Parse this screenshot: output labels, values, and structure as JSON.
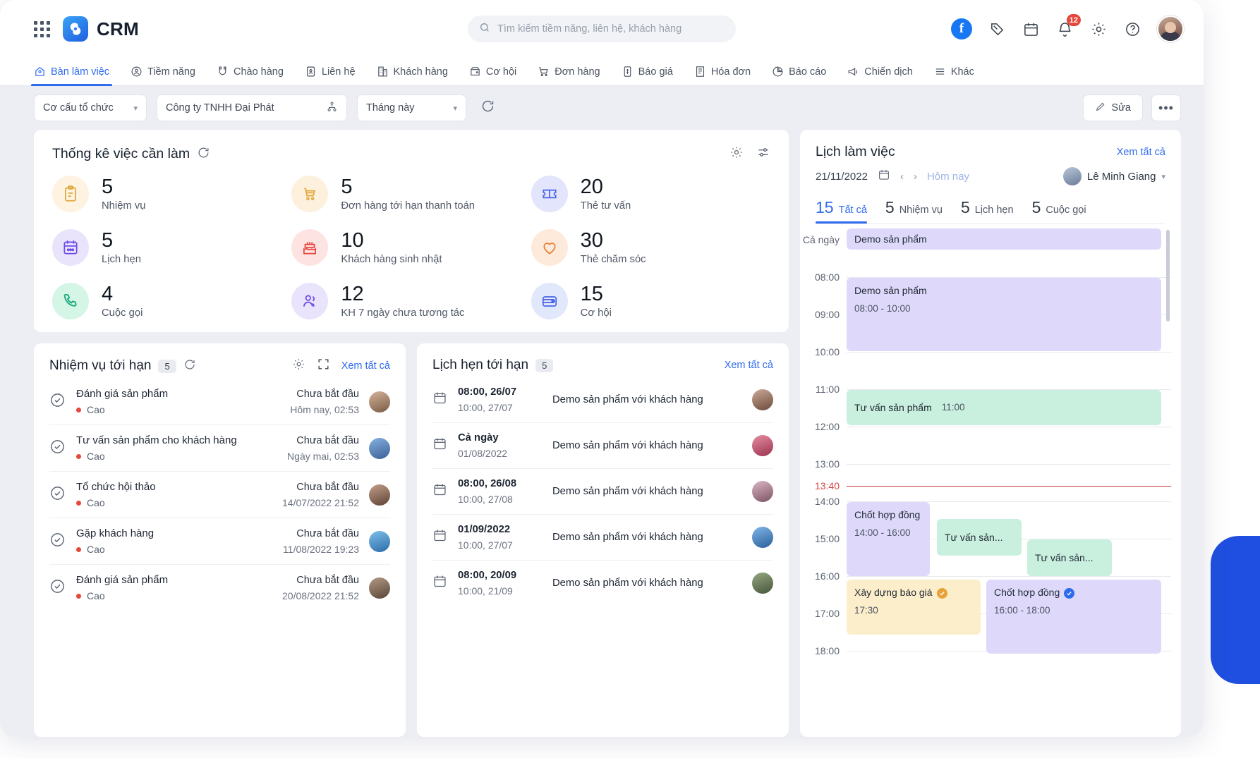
{
  "header": {
    "brand": "CRM",
    "grid_icon": "apps-grid-icon",
    "search": {
      "placeholder": "Tìm kiếm tiềm năng, liên hệ, khách hàng",
      "value": ""
    },
    "icons": {
      "facebook": "f",
      "zalo": "zalo-icon",
      "calendar": "calendar-icon",
      "bell": "bell-icon",
      "settings": "gear-icon",
      "help": "help-icon",
      "avatar": "user-avatar"
    },
    "notification_count": "12"
  },
  "nav": {
    "tabs": [
      {
        "label": "Bàn làm việc",
        "icon": "workspace-icon",
        "active": true
      },
      {
        "label": "Tiềm năng",
        "icon": "lead-icon",
        "active": false
      },
      {
        "label": "Chào hàng",
        "icon": "offer-icon",
        "active": false
      },
      {
        "label": "Liên hệ",
        "icon": "contact-icon",
        "active": false
      },
      {
        "label": "Khách hàng",
        "icon": "customer-icon",
        "active": false
      },
      {
        "label": "Cơ hội",
        "icon": "opportunity-icon",
        "active": false
      },
      {
        "label": "Đơn hàng",
        "icon": "order-cart-icon",
        "active": false
      },
      {
        "label": "Báo giá",
        "icon": "quote-icon",
        "active": false
      },
      {
        "label": "Hóa đơn",
        "icon": "invoice-icon",
        "active": false
      },
      {
        "label": "Báo cáo",
        "icon": "report-chart-icon",
        "active": false
      },
      {
        "label": "Chiến dịch",
        "icon": "campaign-icon",
        "active": false
      },
      {
        "label": "Khác",
        "icon": "more-menu-icon",
        "active": false
      }
    ]
  },
  "filterbar": {
    "org_structure": "Cơ cấu tổ chức",
    "company": "Công ty TNHH Đại Phát",
    "period": "Tháng này",
    "refresh_icon": "refresh-icon",
    "edit_label": "Sửa",
    "more_label": "•••"
  },
  "stats": {
    "title": "Thống kê việc cần làm",
    "refresh_icon": "refresh-icon",
    "gear_icon": "gear-icon",
    "filter_icon": "sliders-icon",
    "items": [
      {
        "value": "5",
        "label": "Nhiệm vụ",
        "icon": "clipboard-icon",
        "color": "#e0a73a",
        "bg": "#fdf3e0"
      },
      {
        "value": "5",
        "label": "Đơn hàng tới hạn thanh toán",
        "icon": "cart-icon",
        "color": "#e0a73a",
        "bg": "#fdf0dc"
      },
      {
        "value": "20",
        "label": "Thẻ tư vấn",
        "icon": "ticket-icon",
        "color": "#4a63e8",
        "bg": "#e2e5fb"
      },
      {
        "value": "5",
        "label": "Lịch hẹn",
        "icon": "calendar-icon",
        "color": "#6b4ae8",
        "bg": "#e9e4fc"
      },
      {
        "value": "10",
        "label": "Khách hàng sinh nhật",
        "icon": "cake-icon",
        "color": "#e8453c",
        "bg": "#fde3e2"
      },
      {
        "value": "30",
        "label": "Thẻ chăm sóc",
        "icon": "heart-icon",
        "color": "#e8823a",
        "bg": "#fdeadb"
      },
      {
        "value": "4",
        "label": "Cuộc gọi",
        "icon": "phone-icon",
        "color": "#17a97c",
        "bg": "#d5f5e6"
      },
      {
        "value": "12",
        "label": "KH 7 ngày chưa tương tác",
        "icon": "users-icon",
        "color": "#6b4ae8",
        "bg": "#e9e4fc"
      },
      {
        "value": "15",
        "label": "Cơ hội",
        "icon": "wallet-icon",
        "color": "#4a63e8",
        "bg": "#e2e8fb"
      }
    ]
  },
  "tasks": {
    "title": "Nhiệm vụ tới hạn",
    "count": "5",
    "refresh_icon": "refresh-icon",
    "gear_icon": "gear-icon",
    "expand_icon": "expand-icon",
    "see_all": "Xem tất cả",
    "rows": [
      {
        "title": "Đánh giá sản phẩm",
        "priority": "Cao",
        "status": "Chưa bắt đầu",
        "date": "Hôm nay, 02:53",
        "avatar": "#b58b6a"
      },
      {
        "title": "Tư vấn sản phẩm cho khách hàng",
        "priority": "Cao",
        "status": "Chưa bắt đầu",
        "date": "Ngày mai, 02:53",
        "avatar": "#4a78c8"
      },
      {
        "title": "Tổ chức hội thảo",
        "priority": "Cao",
        "status": "Chưa bắt đầu",
        "date": "14/07/2022 21:52",
        "avatar": "#8a6a5a"
      },
      {
        "title": "Gặp khách hàng",
        "priority": "Cao",
        "status": "Chưa bắt đầu",
        "date": "11/08/2022 19:23",
        "avatar": "#3f86c4"
      },
      {
        "title": "Đánh giá sản phẩm",
        "priority": "Cao",
        "status": "Chưa bắt đầu",
        "date": "20/08/2022 21:52",
        "avatar": "#6b5a4a"
      }
    ]
  },
  "appointments": {
    "title": "Lịch hẹn tới hạn",
    "count": "5",
    "see_all": "Xem tất cả",
    "calendar_icon": "calendar-icon",
    "rows": [
      {
        "start": "08:00, 26/07",
        "end": "10:00, 27/07",
        "title": "Demo sản phẩm với khách hàng",
        "avatar": "#9a7a6a"
      },
      {
        "start": "Cả ngày",
        "end": "01/08/2022",
        "title": "Demo sản phẩm với khách hàng",
        "avatar": "#c4566a"
      },
      {
        "start": "08:00, 26/08",
        "end": "10:00, 27/08",
        "title": "Demo sản phẩm với khách hàng",
        "avatar": "#b08a9a"
      },
      {
        "start": "01/09/2022",
        "end": "10:00, 27/07",
        "title": "Demo sản phẩm với khách hàng",
        "avatar": "#4a86c8"
      },
      {
        "start": "08:00, 20/09",
        "end": "10:00, 21/09",
        "title": "Demo sản phẩm với khách hàng",
        "avatar": "#5a6a4a"
      }
    ]
  },
  "calendar": {
    "title": "Lịch làm việc",
    "see_all": "Xem tất cả",
    "date": "21/11/2022",
    "date_icon": "calendar-icon",
    "prev_icon": "chevron-left-icon",
    "next_icon": "chevron-right-icon",
    "today_label": "Hôm nay",
    "user": "Lê Minh Giang",
    "tabs": [
      {
        "count": "15",
        "label": "Tất cả",
        "active": true
      },
      {
        "count": "5",
        "label": "Nhiệm vụ",
        "active": false
      },
      {
        "count": "5",
        "label": "Lịch hẹn",
        "active": false
      },
      {
        "count": "5",
        "label": "Cuộc gọi",
        "active": false
      }
    ],
    "allday_label": "Cả ngày",
    "allday_event": "Demo sản phẩm",
    "hours": [
      "08:00",
      "09:00",
      "10:00",
      "11:00",
      "12:00",
      "13:00",
      "14:00",
      "15:00",
      "16:00",
      "17:00",
      "18:00"
    ],
    "now_time": "13:40",
    "events": [
      {
        "title": "Demo sản phẩm",
        "time": "08:00 - 10:00",
        "color": "purple",
        "badge": ""
      },
      {
        "title": "Tư vấn sản phẩm",
        "time": "11:00",
        "color": "green",
        "badge": ""
      },
      {
        "title": "Chốt hợp đồng",
        "time": "14:00 - 16:00",
        "color": "purple",
        "badge": ""
      },
      {
        "title": "Tư vấn sản...",
        "time": "",
        "color": "green",
        "badge": ""
      },
      {
        "title": "Tư vấn sản...",
        "time": "",
        "color": "green",
        "badge": ""
      },
      {
        "title": "Xây dựng báo giá",
        "time": "17:30",
        "color": "yellow",
        "badge": "check-amber"
      },
      {
        "title": "Chốt hợp đồng",
        "time": "16:00 - 18:00",
        "color": "purple",
        "badge": "check-blue"
      }
    ]
  }
}
